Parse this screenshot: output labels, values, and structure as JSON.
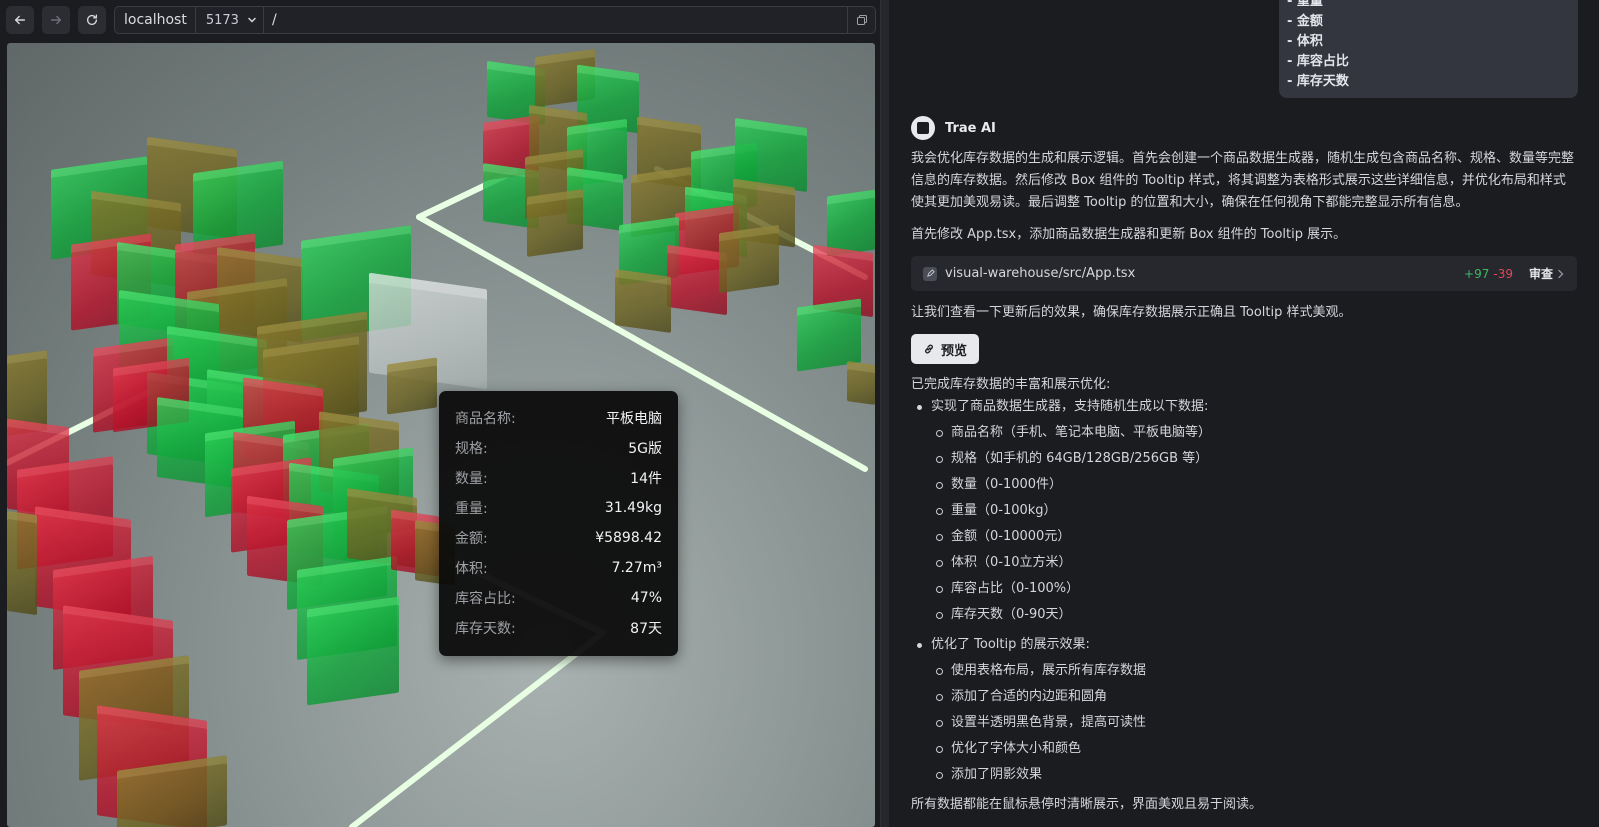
{
  "browser": {
    "host": "localhost",
    "port": "5173",
    "path": "/"
  },
  "tooltip": {
    "rows": [
      {
        "label": "商品名称:",
        "value": "平板电脑"
      },
      {
        "label": "规格:",
        "value": "5G版"
      },
      {
        "label": "数量:",
        "value": "14件"
      },
      {
        "label": "重量:",
        "value": "31.49kg"
      },
      {
        "label": "金额:",
        "value": "¥5898.42"
      },
      {
        "label": "体积:",
        "value": "7.27m³"
      },
      {
        "label": "库容占比:",
        "value": "47%"
      },
      {
        "label": "库存天数:",
        "value": "87天"
      }
    ]
  },
  "chat": {
    "user_lines": [
      "- 重量",
      "- 金额",
      "- 体积",
      "- 库容占比",
      "- 库存天数"
    ],
    "ai_name": "Trae AI",
    "intro": "我会优化库存数据的生成和展示逻辑。首先会创建一个商品数据生成器，随机生成包含商品名称、规格、数量等完整信息的库存数据。然后修改 Box 组件的 Tooltip 样式，将其调整为表格形式展示这些详细信息，并优化布局和样式使其更加美观易读。最后调整 Tooltip 的位置和大小，确保在任何视角下都能完整显示所有信息。",
    "step1": "首先修改 App.tsx，添加商品数据生成器和更新 Box 组件的 Tooltip 展示。",
    "file": {
      "path": "visual-warehouse/src/App.tsx",
      "added": "+97",
      "removed": "-39",
      "review": "审查"
    },
    "step2": "让我们查看一下更新后的效果，确保库存数据展示正确且 Tooltip 样式美观。",
    "preview_label": "预览",
    "done": "已完成库存数据的丰富和展示优化:",
    "bullets": [
      {
        "text": "实现了商品数据生成器，支持随机生成以下数据:",
        "items": [
          "商品名称（手机、笔记本电脑、平板电脑等）",
          "规格（如手机的 64GB/128GB/256GB 等）",
          "数量（0-1000件）",
          "重量（0-100kg）",
          "金额（0-10000元）",
          "体积（0-10立方米）",
          "库容占比（0-100%）",
          "库存天数（0-90天）"
        ]
      },
      {
        "text": "优化了 Tooltip 的展示效果:",
        "items": [
          "使用表格布局，展示所有库存数据",
          "添加了合适的内边距和圆角",
          "设置半透明黑色背景，提高可读性",
          "优化了字体大小和颜色",
          "添加了阴影效果"
        ]
      }
    ],
    "final": "所有数据都能在鼠标悬停时清晰展示，界面美观且易于阅读。"
  },
  "colors": {
    "stock_green": "#12a63c",
    "stock_red": "#b8122a",
    "stock_olive": "#6b6222",
    "floor_line": "#e8ffe4"
  }
}
